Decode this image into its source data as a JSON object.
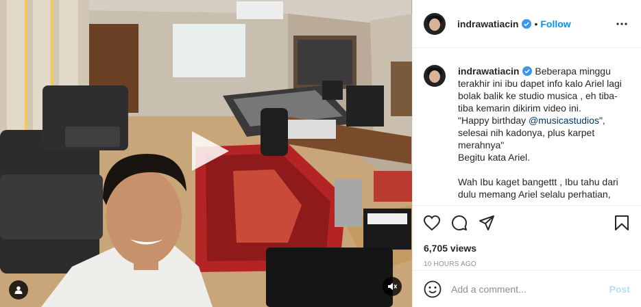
{
  "post": {
    "username": "indrawatiacin",
    "verified": true,
    "follow_label": "Follow",
    "dot": "•",
    "caption_lines": [
      "Beberapa minggu terakhir ini ibu dapet info kalo Ariel lagi bolak balik ke studio musica , eh tiba-tiba kemarin dikirim video ini."
    ],
    "quote_prefix": "\"Happy birthday ",
    "mention": "@musicastudios",
    "quote_suffix": "\", selesai nih kadonya, plus karpet merahnya\"",
    "line_ariel": "Begitu kata Ariel.",
    "line_wah": "Wah Ibu kaget bangettt , Ibu tahu dari dulu memang Ariel selalu perhatian,",
    "views": "6,705 views",
    "time": "10 HOURS AGO"
  },
  "comment": {
    "placeholder": "Add a comment...",
    "post_label": "Post"
  },
  "colors": {
    "link": "#0095f6",
    "mention": "#00376b",
    "muted": "#8e8e8e",
    "post_disabled": "#b2dffc"
  },
  "icons": [
    "verified-badge-icon",
    "more-options-icon",
    "heart-icon",
    "comment-icon",
    "share-icon",
    "bookmark-icon",
    "emoji-icon",
    "play-icon",
    "user-tag-icon",
    "mute-icon"
  ]
}
